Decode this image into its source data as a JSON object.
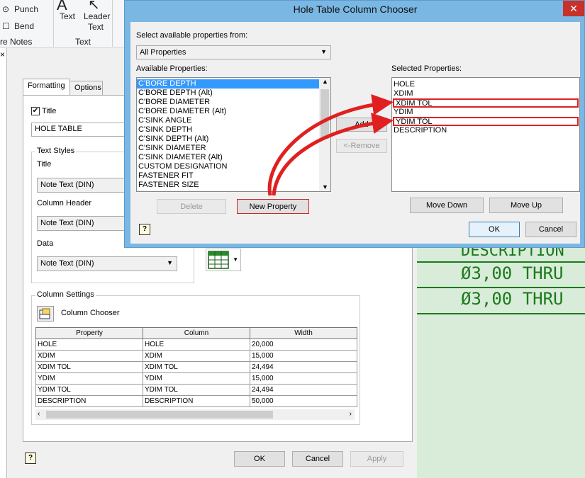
{
  "ribbon": {
    "punch": "Punch",
    "bend": "Bend",
    "notes_group": "re Notes",
    "text": "Text",
    "leader_text_1": "Leader",
    "leader_text_2": "Text",
    "text_group": "Text",
    "close_x": "×"
  },
  "canvas": {
    "row0": "DESCRIPTION",
    "row1": "Ø3,00 THRU",
    "row2": "Ø3,00 THRU"
  },
  "panel": {
    "tabs": [
      "Formatting",
      "Options"
    ],
    "title_check_label": "Title",
    "title_value": "HOLE TABLE",
    "text_styles_label": "Text Styles",
    "title_style_label": "Title",
    "title_style_value": "Note Text (DIN)",
    "column_header_label": "Column Header",
    "column_header_value": "Note Text (DIN)",
    "data_label": "Data",
    "data_value": "Note Text (DIN)",
    "column_settings_label": "Column Settings",
    "column_chooser_label": "Column Chooser",
    "grid_headers": [
      "Property",
      "Column",
      "Width"
    ],
    "grid_rows": [
      [
        "HOLE",
        "HOLE",
        "20,000"
      ],
      [
        "XDIM",
        "XDIM",
        "15,000"
      ],
      [
        "XDIM TOL",
        "XDIM TOL",
        "24,494"
      ],
      [
        "YDIM",
        "YDIM",
        "15,000"
      ],
      [
        "YDIM TOL",
        "YDIM TOL",
        "24,494"
      ],
      [
        "DESCRIPTION",
        "DESCRIPTION",
        "50,000"
      ]
    ],
    "ok": "OK",
    "cancel": "Cancel",
    "apply": "Apply"
  },
  "dialog": {
    "title": "Hole Table Column Chooser",
    "select_from_label": "Select available properties from:",
    "select_from_value": "All Properties",
    "available_label": "Available Properties:",
    "available_items": [
      "C'BORE DEPTH",
      "C'BORE DEPTH (Alt)",
      "C'BORE DIAMETER",
      "C'BORE DIAMETER (Alt)",
      "C'SINK ANGLE",
      "C'SINK DEPTH",
      "C'SINK DEPTH (Alt)",
      "C'SINK DIAMETER",
      "C'SINK DIAMETER (Alt)",
      "CUSTOM DESIGNATION",
      "FASTENER FIT",
      "FASTENER SIZE"
    ],
    "selected_label": "Selected Properties:",
    "selected_items": [
      "HOLE",
      "XDIM",
      "XDIM TOL",
      "YDIM",
      "YDIM TOL",
      "DESCRIPTION"
    ],
    "add": "Add",
    "remove": "<-Remove",
    "delete": "Delete",
    "new_property": "New Property",
    "move_down": "Move Down",
    "move_up": "Move Up",
    "ok": "OK",
    "cancel": "Cancel"
  },
  "colors": {
    "accent_red": "#e02020",
    "canvas_green": "#1b7a1b",
    "selection_blue": "#3399ff"
  }
}
